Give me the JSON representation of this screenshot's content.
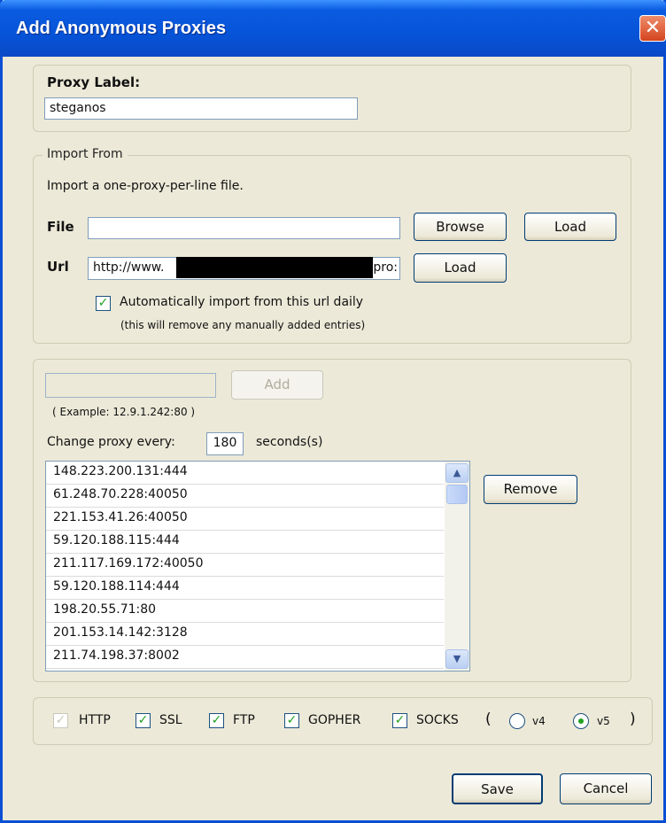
{
  "window": {
    "title": "Add Anonymous Proxies",
    "close": "✕"
  },
  "proxy_label": {
    "label": "Proxy Label:",
    "value": "steganos"
  },
  "import_from": {
    "legend": "Import From",
    "description": "Import a one-proxy-per-line file.",
    "file_label": "File",
    "file_value": "",
    "browse": "Browse",
    "load_file": "Load",
    "url_label": "Url",
    "url_value_start": "http://www.",
    "url_value_end": "epro:",
    "load_url": "Load",
    "auto_import": {
      "label": "Automatically import from this url daily",
      "checked": true,
      "note": "(this will remove any manually added entries)"
    }
  },
  "manual": {
    "add_value": "",
    "add": "Add",
    "example": "( Example: 12.9.1.242:80 )",
    "change_label": "Change proxy every:",
    "interval": "180",
    "unit": "seconds(s)",
    "remove": "Remove"
  },
  "proxies": [
    "148.223.200.131:444",
    "61.248.70.228:40050",
    "221.153.41.26:40050",
    "59.120.188.115:444",
    "211.117.169.172:40050",
    "59.120.188.114:444",
    "198.20.55.71:80",
    "201.153.14.142:3128",
    "211.74.198.37:8002"
  ],
  "protocols": {
    "http": "HTTP",
    "ssl": "SSL",
    "ftp": "FTP",
    "gopher": "GOPHER",
    "socks": "SOCKS",
    "open_paren": "(",
    "v4": "v4",
    "v5": "v5",
    "close_paren": ")",
    "selected_socks_version": "v5"
  },
  "footer": {
    "save": "Save",
    "cancel": "Cancel"
  }
}
